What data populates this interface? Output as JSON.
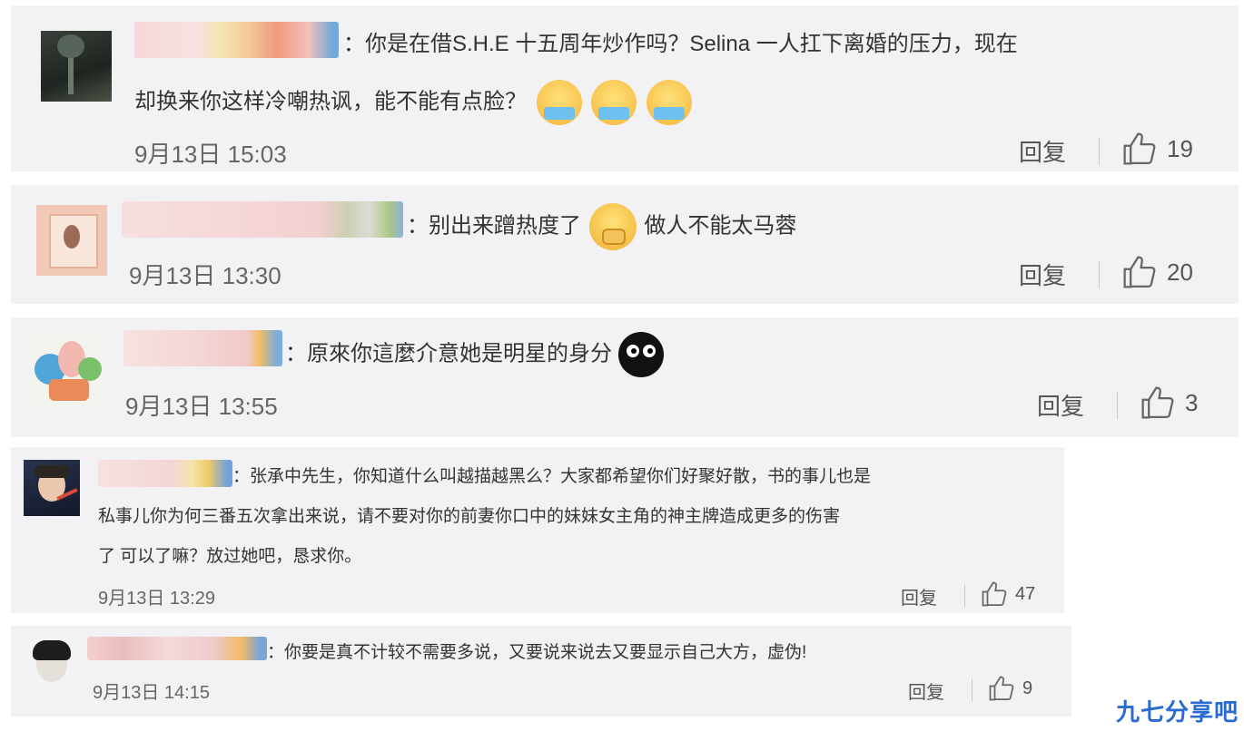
{
  "comments": [
    {
      "text_line1": "：你是在借S.H.E 十五周年炒作吗？Selina 一人扛下离婚的压力，现在",
      "text_line2": "却换来你这样冷嘲热讽，能不能有点脸？",
      "emoji": [
        "sweat-laugh-emoji",
        "sweat-laugh-emoji",
        "sweat-laugh-emoji"
      ],
      "time": "9月13日 15:03",
      "reply_label": "回复",
      "likes": "19"
    },
    {
      "text_line1": "：别出来蹭热度了",
      "text_after_emoji": "做人不能太马蓉",
      "emoji": [
        "thinking-emoji"
      ],
      "time": "9月13日 13:30",
      "reply_label": "回复",
      "likes": "20"
    },
    {
      "text_line1": "：原來你這麼介意她是明星的身分",
      "emoji": [
        "black-eyes-emoji"
      ],
      "time": "9月13日 13:55",
      "reply_label": "回复",
      "likes": "3"
    },
    {
      "text_line1": "：张承中先生，你知道什么叫越描越黑么？大家都希望你们好聚好散，书的事儿也是",
      "text_line2": "私事儿你为何三番五次拿出来说，请不要对你的前妻你口中的妹妹女主角的神主牌造成更多的伤害",
      "text_line3": "了 可以了嘛？放过她吧，恳求你。",
      "time": "9月13日 13:29",
      "reply_label": "回复",
      "likes": "47"
    },
    {
      "text_line1": "：你要是真不计较不需要多说，又要说来说去又要显示自己大方，虚伪!",
      "time": "9月13日 14:15",
      "reply_label": "回复",
      "likes": "9"
    }
  ],
  "watermark": "九七分享吧",
  "colors": {
    "card_bg": "#f2f2f5",
    "text": "#333333",
    "meta": "#666666",
    "watermark": "#2a6bd1"
  }
}
